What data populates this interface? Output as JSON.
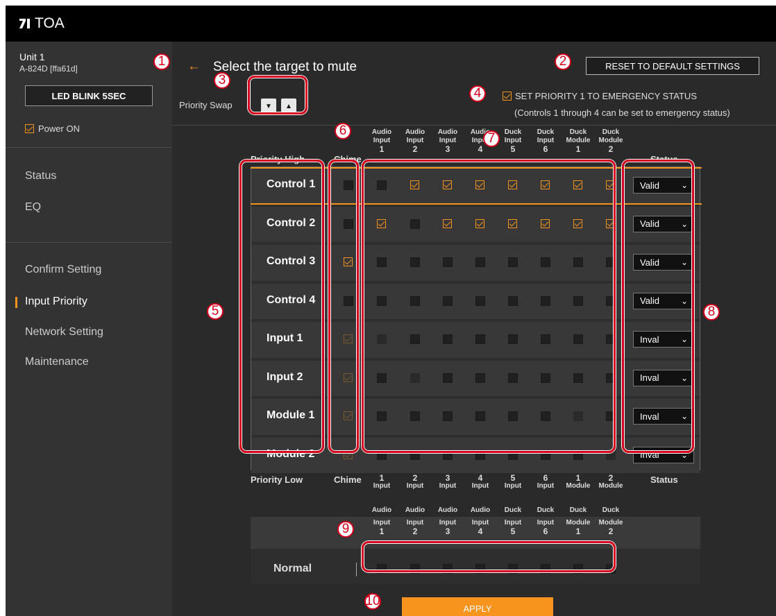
{
  "brand": {
    "logo_text": "TOA"
  },
  "sidebar": {
    "unit_name": "Unit 1",
    "unit_model": "A-824D [ffa61d]",
    "blink_label": "LED BLINK 5SEC",
    "power_label": "Power ON",
    "power_checked": true,
    "nav_top": [
      {
        "label": "Status"
      },
      {
        "label": "EQ"
      }
    ],
    "nav_bottom": [
      {
        "label": "Confirm Setting",
        "active": false
      },
      {
        "label": "Input Priority",
        "active": true
      },
      {
        "label": "Network Setting",
        "active": false
      },
      {
        "label": "Maintenance",
        "active": false
      }
    ]
  },
  "main": {
    "title": "Select the target to mute",
    "back_icon": "left-arrow-icon",
    "reset_label": "RESET TO DEFAULT SETTINGS",
    "swap_label": "Priority Swap",
    "priority1_label": "SET PRIORITY 1 TO EMERGENCY STATUS",
    "priority1_note": "(Controls 1 through 4 can be set to emergency status)",
    "priority1_checked": true,
    "priority_high": "Priority High",
    "priority_low": "Priority Low",
    "chime_label": "Chime",
    "status_label": "Status",
    "apply_label": "APPLY",
    "normal_label": "Normal"
  },
  "columns_top": [
    {
      "a": "Audio",
      "b": "Input",
      "n": "1"
    },
    {
      "a": "Audio",
      "b": "Input",
      "n": "2"
    },
    {
      "a": "Audio",
      "b": "Input",
      "n": "3"
    },
    {
      "a": "Audio",
      "b": "Input",
      "n": "4"
    },
    {
      "a": "Duck",
      "b": "Input",
      "n": "5"
    },
    {
      "a": "Duck",
      "b": "Input",
      "n": "6"
    },
    {
      "a": "Duck",
      "b": "Module",
      "n": "1"
    },
    {
      "a": "Duck",
      "b": "Module",
      "n": "2"
    }
  ],
  "columns_bottom": [
    {
      "n": "1",
      "b": "Input"
    },
    {
      "n": "2",
      "b": "Input"
    },
    {
      "n": "3",
      "b": "Input"
    },
    {
      "n": "4",
      "b": "Input"
    },
    {
      "n": "5",
      "b": "Input"
    },
    {
      "n": "6",
      "b": "Input"
    },
    {
      "n": "1",
      "b": "Module"
    },
    {
      "n": "2",
      "b": "Module"
    }
  ],
  "rows": [
    {
      "label": "Control 1",
      "chime": "off",
      "cells": [
        "off",
        "on",
        "on",
        "on",
        "on",
        "on",
        "on",
        "on"
      ],
      "status": "Valid"
    },
    {
      "label": "Control 2",
      "chime": "off",
      "cells": [
        "on",
        "off",
        "on",
        "on",
        "on",
        "on",
        "on",
        "on"
      ],
      "status": "Valid"
    },
    {
      "label": "Control 3",
      "chime": "on",
      "cells": [
        "off",
        "off",
        "off",
        "off",
        "off",
        "off",
        "off",
        "off"
      ],
      "status": "Valid"
    },
    {
      "label": "Control 4",
      "chime": "off",
      "cells": [
        "off",
        "off",
        "off",
        "off",
        "off",
        "off",
        "off",
        "off"
      ],
      "status": "Valid"
    },
    {
      "label": "Input 1",
      "chime": "dim",
      "cells": [
        "dim",
        "off",
        "off",
        "off",
        "off",
        "off",
        "off",
        "off"
      ],
      "status": "Inval"
    },
    {
      "label": "Input 2",
      "chime": "dim",
      "cells": [
        "off",
        "dim",
        "off",
        "off",
        "off",
        "off",
        "off",
        "off"
      ],
      "status": "Inval"
    },
    {
      "label": "Module 1",
      "chime": "dim",
      "cells": [
        "off",
        "off",
        "off",
        "off",
        "off",
        "off",
        "dim",
        "off"
      ],
      "status": "Inval"
    },
    {
      "label": "Module 2",
      "chime": "dim",
      "cells": [
        "off",
        "off",
        "off",
        "off",
        "off",
        "off",
        "off",
        "dim"
      ],
      "status": "Inval"
    }
  ],
  "normal_cells": [
    "off",
    "off",
    "off",
    "off",
    "off",
    "off",
    "off",
    "off"
  ],
  "callouts": [
    "1",
    "2",
    "3",
    "4",
    "5",
    "6",
    "7",
    "8",
    "9",
    "10"
  ]
}
